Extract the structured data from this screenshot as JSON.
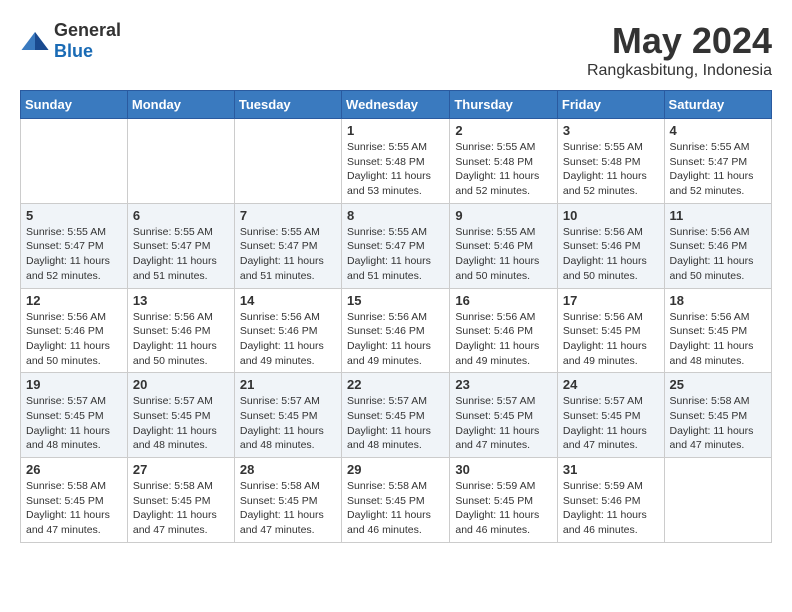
{
  "logo": {
    "text_general": "General",
    "text_blue": "Blue"
  },
  "title": {
    "month_year": "May 2024",
    "location": "Rangkasbitung, Indonesia"
  },
  "weekdays": [
    "Sunday",
    "Monday",
    "Tuesday",
    "Wednesday",
    "Thursday",
    "Friday",
    "Saturday"
  ],
  "weeks": [
    [
      {
        "day": "",
        "info": ""
      },
      {
        "day": "",
        "info": ""
      },
      {
        "day": "",
        "info": ""
      },
      {
        "day": "1",
        "info": "Sunrise: 5:55 AM\nSunset: 5:48 PM\nDaylight: 11 hours\nand 53 minutes."
      },
      {
        "day": "2",
        "info": "Sunrise: 5:55 AM\nSunset: 5:48 PM\nDaylight: 11 hours\nand 52 minutes."
      },
      {
        "day": "3",
        "info": "Sunrise: 5:55 AM\nSunset: 5:48 PM\nDaylight: 11 hours\nand 52 minutes."
      },
      {
        "day": "4",
        "info": "Sunrise: 5:55 AM\nSunset: 5:47 PM\nDaylight: 11 hours\nand 52 minutes."
      }
    ],
    [
      {
        "day": "5",
        "info": "Sunrise: 5:55 AM\nSunset: 5:47 PM\nDaylight: 11 hours\nand 52 minutes."
      },
      {
        "day": "6",
        "info": "Sunrise: 5:55 AM\nSunset: 5:47 PM\nDaylight: 11 hours\nand 51 minutes."
      },
      {
        "day": "7",
        "info": "Sunrise: 5:55 AM\nSunset: 5:47 PM\nDaylight: 11 hours\nand 51 minutes."
      },
      {
        "day": "8",
        "info": "Sunrise: 5:55 AM\nSunset: 5:47 PM\nDaylight: 11 hours\nand 51 minutes."
      },
      {
        "day": "9",
        "info": "Sunrise: 5:55 AM\nSunset: 5:46 PM\nDaylight: 11 hours\nand 50 minutes."
      },
      {
        "day": "10",
        "info": "Sunrise: 5:56 AM\nSunset: 5:46 PM\nDaylight: 11 hours\nand 50 minutes."
      },
      {
        "day": "11",
        "info": "Sunrise: 5:56 AM\nSunset: 5:46 PM\nDaylight: 11 hours\nand 50 minutes."
      }
    ],
    [
      {
        "day": "12",
        "info": "Sunrise: 5:56 AM\nSunset: 5:46 PM\nDaylight: 11 hours\nand 50 minutes."
      },
      {
        "day": "13",
        "info": "Sunrise: 5:56 AM\nSunset: 5:46 PM\nDaylight: 11 hours\nand 50 minutes."
      },
      {
        "day": "14",
        "info": "Sunrise: 5:56 AM\nSunset: 5:46 PM\nDaylight: 11 hours\nand 49 minutes."
      },
      {
        "day": "15",
        "info": "Sunrise: 5:56 AM\nSunset: 5:46 PM\nDaylight: 11 hours\nand 49 minutes."
      },
      {
        "day": "16",
        "info": "Sunrise: 5:56 AM\nSunset: 5:46 PM\nDaylight: 11 hours\nand 49 minutes."
      },
      {
        "day": "17",
        "info": "Sunrise: 5:56 AM\nSunset: 5:45 PM\nDaylight: 11 hours\nand 49 minutes."
      },
      {
        "day": "18",
        "info": "Sunrise: 5:56 AM\nSunset: 5:45 PM\nDaylight: 11 hours\nand 48 minutes."
      }
    ],
    [
      {
        "day": "19",
        "info": "Sunrise: 5:57 AM\nSunset: 5:45 PM\nDaylight: 11 hours\nand 48 minutes."
      },
      {
        "day": "20",
        "info": "Sunrise: 5:57 AM\nSunset: 5:45 PM\nDaylight: 11 hours\nand 48 minutes."
      },
      {
        "day": "21",
        "info": "Sunrise: 5:57 AM\nSunset: 5:45 PM\nDaylight: 11 hours\nand 48 minutes."
      },
      {
        "day": "22",
        "info": "Sunrise: 5:57 AM\nSunset: 5:45 PM\nDaylight: 11 hours\nand 48 minutes."
      },
      {
        "day": "23",
        "info": "Sunrise: 5:57 AM\nSunset: 5:45 PM\nDaylight: 11 hours\nand 47 minutes."
      },
      {
        "day": "24",
        "info": "Sunrise: 5:57 AM\nSunset: 5:45 PM\nDaylight: 11 hours\nand 47 minutes."
      },
      {
        "day": "25",
        "info": "Sunrise: 5:58 AM\nSunset: 5:45 PM\nDaylight: 11 hours\nand 47 minutes."
      }
    ],
    [
      {
        "day": "26",
        "info": "Sunrise: 5:58 AM\nSunset: 5:45 PM\nDaylight: 11 hours\nand 47 minutes."
      },
      {
        "day": "27",
        "info": "Sunrise: 5:58 AM\nSunset: 5:45 PM\nDaylight: 11 hours\nand 47 minutes."
      },
      {
        "day": "28",
        "info": "Sunrise: 5:58 AM\nSunset: 5:45 PM\nDaylight: 11 hours\nand 47 minutes."
      },
      {
        "day": "29",
        "info": "Sunrise: 5:58 AM\nSunset: 5:45 PM\nDaylight: 11 hours\nand 46 minutes."
      },
      {
        "day": "30",
        "info": "Sunrise: 5:59 AM\nSunset: 5:45 PM\nDaylight: 11 hours\nand 46 minutes."
      },
      {
        "day": "31",
        "info": "Sunrise: 5:59 AM\nSunset: 5:46 PM\nDaylight: 11 hours\nand 46 minutes."
      },
      {
        "day": "",
        "info": ""
      }
    ]
  ]
}
